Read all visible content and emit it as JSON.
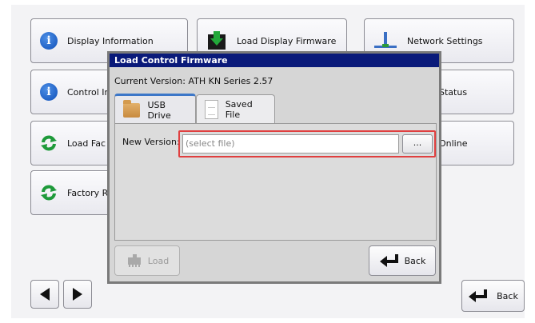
{
  "tiles": {
    "display_information": "Display Information",
    "load_display_firmware": "Load Display Firmware",
    "network_settings": "Network Settings",
    "control_info": "Control In",
    "status": "Status",
    "load_factory": "Load Fac",
    "online": "Online",
    "factory_reset": "Factory R"
  },
  "dialog": {
    "title": "Load Control Firmware",
    "current_version": "Current Version: ATH KN Series 2.57",
    "tabs": [
      {
        "label": "USB Drive",
        "icon": "folder-icon",
        "active": true
      },
      {
        "label": "Saved File",
        "icon": "file-icon",
        "active": false
      }
    ],
    "new_version_label": "New Version:",
    "file_placeholder": "(select file)",
    "browse_label": "...",
    "load_label": "Load",
    "back_label": "Back"
  },
  "footer": {
    "back_label": "Back"
  },
  "colors": {
    "title_bar": "#0a1a7a",
    "highlight": "#e04040",
    "info_icon": "#1a5fc8",
    "refresh_icon": "#1e9a3a"
  }
}
